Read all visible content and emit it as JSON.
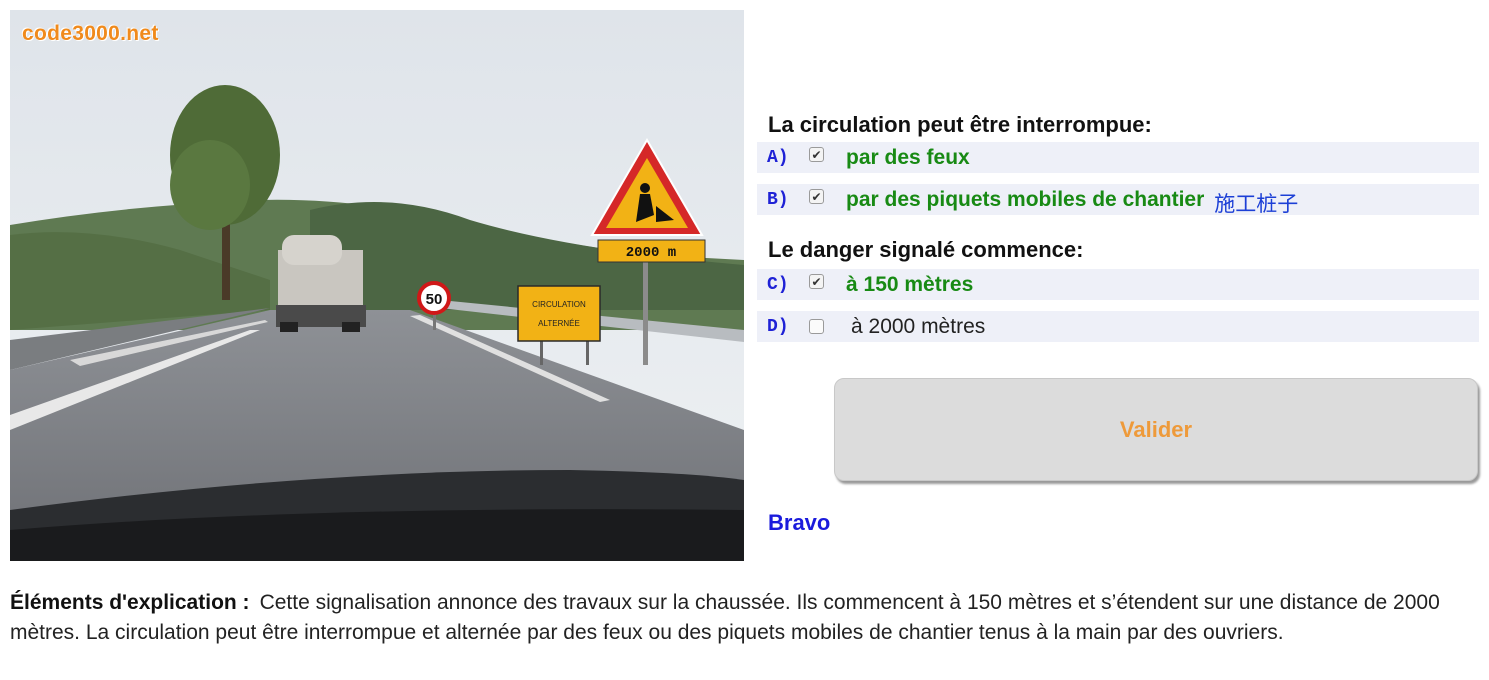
{
  "scene": {
    "logo": "code3000.net",
    "sign_distance_panel": "2000 m",
    "speed_limit": "50",
    "alternating_sign_line1": "CIRCULATION",
    "alternating_sign_line2": "ALTERNÉE"
  },
  "questions": [
    {
      "title": "La circulation peut être interrompue:",
      "options": [
        {
          "letter": "A)",
          "text": "par des feux",
          "checked": true,
          "correct": true,
          "note": ""
        },
        {
          "letter": "B)",
          "text": "par des piquets mobiles de chantier",
          "checked": true,
          "correct": true,
          "note": "施工桩子"
        }
      ]
    },
    {
      "title": "Le danger signalé commence:",
      "options": [
        {
          "letter": "C)",
          "text": "à 150 mètres",
          "checked": true,
          "correct": true
        },
        {
          "letter": "D)",
          "text": "à 2000 mètres",
          "checked": false,
          "correct": false
        }
      ]
    }
  ],
  "validate_label": "Valider",
  "feedback": "Bravo",
  "explanation": {
    "label": "Éléments d'explication :",
    "text": "Cette signalisation annonce des travaux sur la chaussée. Ils commencent à 150 mètres et s’étendent sur une distance de 2000 mètres. La circulation peut être interrompue et alternée par des feux ou des piquets mobiles de chantier tenus à la main par des ouvriers."
  },
  "colors": {
    "correct": "#188a14",
    "letter": "#1f22d6",
    "note": "#1c3fd6",
    "validate_text": "#ee9a3a",
    "feedback": "#1b1bdc",
    "option_bg": "#eef0f8"
  }
}
